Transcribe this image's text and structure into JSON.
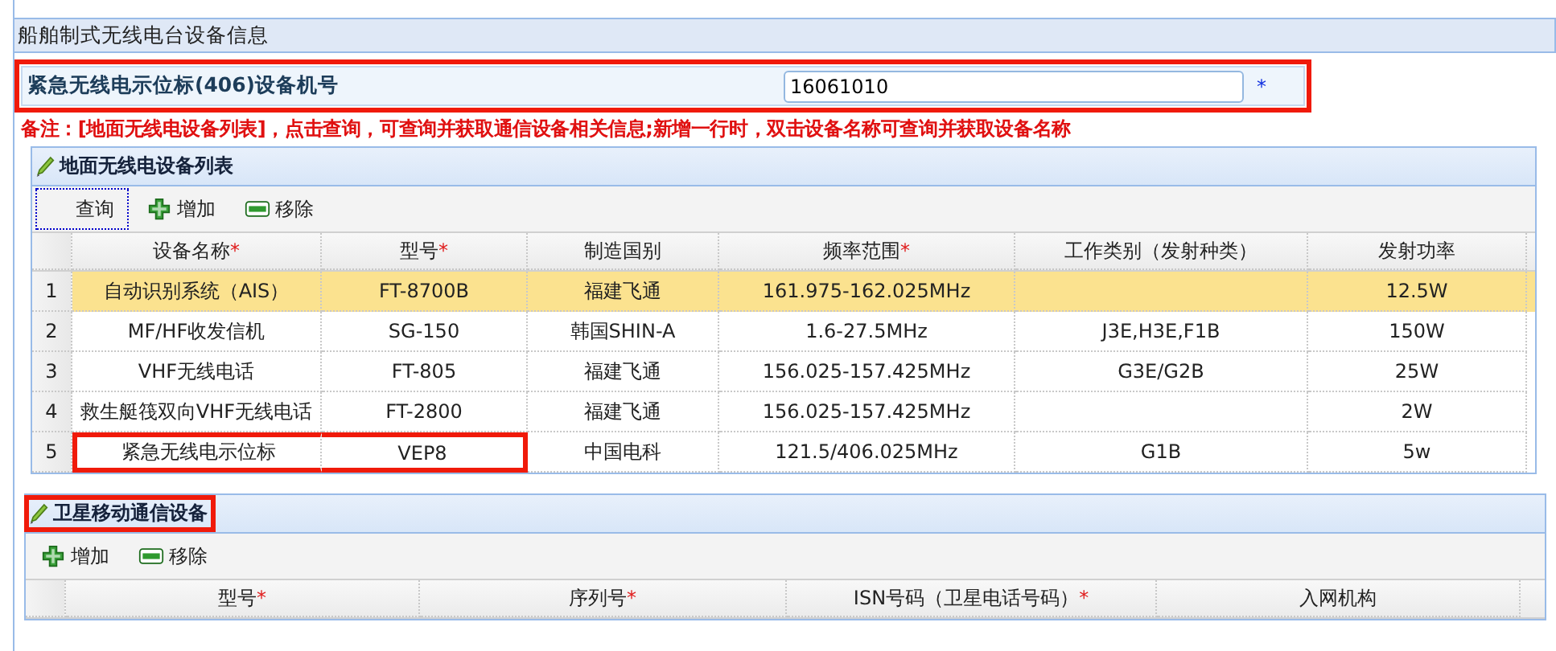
{
  "section_title": "船舶制式无线电台设备信息",
  "field": {
    "label": "紧急无线电示位标(406)设备机号",
    "value": "16061010",
    "required_mark": "*",
    "highlighted": true
  },
  "note": "备注：[地面无线电设备列表]，点击查询，可查询并获取通信设备相关信息;新增一行时，双击设备名称可查询并获取设备名称",
  "ground_list": {
    "title": "地面无线电设备列表",
    "highlighted": false,
    "toolbar": [
      {
        "kind": "query",
        "label": "查询",
        "focused": true
      },
      {
        "kind": "add",
        "label": "增加",
        "focused": false
      },
      {
        "kind": "remove",
        "label": "移除",
        "focused": false
      }
    ],
    "columns": [
      {
        "label": "设备名称",
        "required": true
      },
      {
        "label": "型号",
        "required": true
      },
      {
        "label": "制造国别",
        "required": false
      },
      {
        "label": "频率范围",
        "required": true
      },
      {
        "label": "工作类别（发射种类）",
        "required": false
      },
      {
        "label": "发射功率",
        "required": false
      }
    ],
    "rows": [
      {
        "num": "1",
        "selected": true,
        "highlighted": false,
        "cells": [
          "自动识别系统（AIS）",
          "FT-8700B",
          "福建飞通",
          "161.975-162.025MHz",
          "",
          "12.5W"
        ]
      },
      {
        "num": "2",
        "selected": false,
        "highlighted": false,
        "cells": [
          "MF/HF收发信机",
          "SG-150",
          "韩国SHIN-A",
          "1.6-27.5MHz",
          "J3E,H3E,F1B",
          "150W"
        ]
      },
      {
        "num": "3",
        "selected": false,
        "highlighted": false,
        "cells": [
          "VHF无线电话",
          "FT-805",
          "福建飞通",
          "156.025-157.425MHz",
          "G3E/G2B",
          "25W"
        ]
      },
      {
        "num": "4",
        "selected": false,
        "highlighted": false,
        "cells": [
          "救生艇筏双向VHF无线电话",
          "FT-2800",
          "福建飞通",
          "156.025-157.425MHz",
          "",
          "2W"
        ]
      },
      {
        "num": "5",
        "selected": false,
        "highlighted": true,
        "cells": [
          "紧急无线电示位标",
          "VEP8",
          "中国电科",
          "121.5/406.025MHz",
          "G1B",
          "5w"
        ]
      }
    ]
  },
  "satellite_list": {
    "title": "卫星移动通信设备",
    "highlighted": true,
    "toolbar": [
      {
        "kind": "add",
        "label": "增加",
        "focused": false
      },
      {
        "kind": "remove",
        "label": "移除",
        "focused": false
      }
    ],
    "columns": [
      {
        "label": "型号",
        "required": true
      },
      {
        "label": "序列号",
        "required": true
      },
      {
        "label": "ISN号码（卫星电话号码）",
        "required": true
      },
      {
        "label": "入网机构",
        "required": false
      }
    ]
  }
}
